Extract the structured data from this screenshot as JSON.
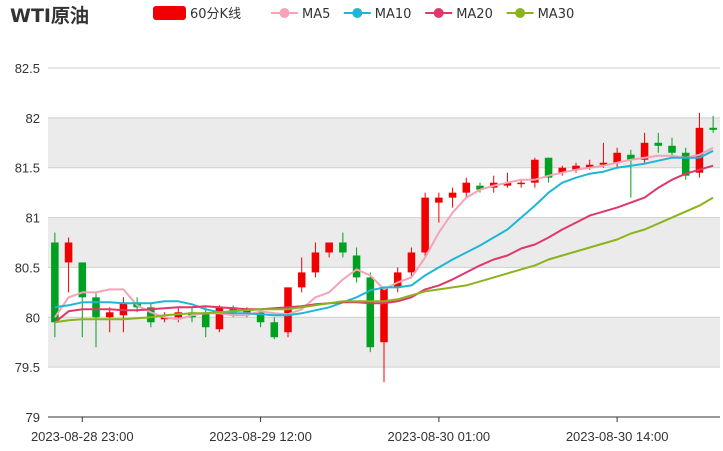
{
  "chart_data": {
    "type": "candlestick",
    "title": "WTI原油",
    "legend": {
      "position": "top",
      "items": [
        {
          "name": "60分K线",
          "color": "#f00000",
          "shape": "rect"
        },
        {
          "name": "MA5",
          "color": "#f5a3b9",
          "shape": "line"
        },
        {
          "name": "MA10",
          "color": "#1fb6d6",
          "shape": "line"
        },
        {
          "name": "MA20",
          "color": "#e0386b",
          "shape": "line"
        },
        {
          "name": "MA30",
          "color": "#8ab41c",
          "shape": "line"
        }
      ]
    },
    "y_axis": {
      "min": 79,
      "max": 82.5,
      "ticks": [
        "79",
        "79.5",
        "80",
        "80.5",
        "81",
        "81.5",
        "82",
        "82.5"
      ]
    },
    "x_axis": {
      "labels": [
        "2023-08-28 23:00",
        "2023-08-29 12:00",
        "2023-08-30 01:00",
        "2023-08-30 14:00"
      ],
      "label_indices": [
        2,
        15,
        28,
        41
      ]
    },
    "grid": "horizontal, alternating shaded bands",
    "up_color": "#f00000",
    "down_color": "#00a020",
    "candles": [
      [
        80.75,
        79.95,
        80.85,
        79.8
      ],
      [
        80.55,
        80.75,
        80.8,
        80.25
      ],
      [
        80.55,
        80.2,
        80.55,
        79.8
      ],
      [
        80.2,
        80.0,
        80.25,
        79.7
      ],
      [
        80.0,
        80.05,
        80.1,
        79.85
      ],
      [
        80.02,
        80.15,
        80.2,
        79.85
      ],
      [
        80.15,
        80.1,
        80.2,
        80.05
      ],
      [
        80.1,
        79.95,
        80.15,
        79.9
      ],
      [
        79.98,
        80.0,
        80.05,
        79.95
      ],
      [
        80.0,
        80.05,
        80.1,
        79.95
      ],
      [
        80.05,
        80.0,
        80.1,
        79.95
      ],
      [
        80.05,
        79.9,
        80.1,
        79.8
      ],
      [
        79.88,
        80.1,
        80.12,
        79.85
      ],
      [
        80.1,
        80.05,
        80.12,
        80.0
      ],
      [
        80.05,
        80.08,
        80.1,
        80.0
      ],
      [
        80.05,
        79.95,
        80.08,
        79.9
      ],
      [
        79.95,
        79.8,
        80.0,
        79.78
      ],
      [
        79.85,
        80.3,
        80.3,
        79.8
      ],
      [
        80.3,
        80.45,
        80.6,
        80.25
      ],
      [
        80.45,
        80.65,
        80.75,
        80.4
      ],
      [
        80.65,
        80.75,
        80.75,
        80.6
      ],
      [
        80.75,
        80.65,
        80.85,
        80.6
      ],
      [
        80.62,
        80.4,
        80.7,
        80.35
      ],
      [
        80.4,
        79.7,
        80.45,
        79.65
      ],
      [
        79.75,
        80.3,
        80.3,
        79.35
      ],
      [
        80.3,
        80.45,
        80.5,
        80.25
      ],
      [
        80.45,
        80.65,
        80.7,
        80.4
      ],
      [
        80.65,
        81.2,
        81.25,
        80.6
      ],
      [
        81.15,
        81.2,
        81.25,
        80.95
      ],
      [
        81.2,
        81.25,
        81.3,
        81.1
      ],
      [
        81.25,
        81.35,
        81.4,
        81.2
      ],
      [
        81.32,
        81.28,
        81.35,
        81.25
      ],
      [
        81.3,
        81.35,
        81.42,
        81.25
      ],
      [
        81.32,
        81.35,
        81.45,
        81.3
      ],
      [
        81.35,
        81.35,
        81.38,
        81.3
      ],
      [
        81.35,
        81.58,
        81.6,
        81.3
      ],
      [
        81.6,
        81.4,
        81.6,
        81.35
      ],
      [
        81.45,
        81.5,
        81.52,
        81.42
      ],
      [
        81.48,
        81.52,
        81.55,
        81.45
      ],
      [
        81.5,
        81.53,
        81.58,
        81.48
      ],
      [
        81.53,
        81.55,
        81.75,
        81.5
      ],
      [
        81.55,
        81.65,
        81.7,
        81.5
      ],
      [
        81.63,
        81.58,
        81.68,
        81.2
      ],
      [
        81.58,
        81.75,
        81.85,
        81.55
      ],
      [
        81.75,
        81.72,
        81.85,
        81.65
      ],
      [
        81.72,
        81.65,
        81.8,
        81.6
      ],
      [
        81.65,
        81.42,
        81.7,
        81.38
      ],
      [
        81.45,
        81.9,
        82.05,
        81.4
      ],
      [
        81.9,
        81.88,
        82.02,
        81.85
      ]
    ],
    "series": [
      {
        "name": "MA5",
        "values": [
          80.0,
          80.2,
          80.25,
          80.25,
          80.28,
          80.28,
          80.12,
          80.05,
          80.0,
          79.98,
          80.02,
          80.04,
          80.04,
          80.02,
          80.02,
          80.06,
          80.04,
          80.03,
          80.08,
          80.2,
          80.25,
          80.38,
          80.48,
          80.42,
          80.28,
          80.35,
          80.4,
          80.6,
          80.85,
          81.05,
          81.2,
          81.28,
          81.32,
          81.35,
          81.38,
          81.38,
          81.42,
          81.45,
          81.48,
          81.5,
          81.52,
          81.55,
          81.58,
          81.6,
          81.62,
          81.62,
          81.6,
          81.63,
          81.7
        ]
      },
      {
        "name": "MA10",
        "values": [
          80.1,
          80.12,
          80.15,
          80.15,
          80.15,
          80.14,
          80.14,
          80.14,
          80.16,
          80.16,
          80.13,
          80.08,
          80.05,
          80.04,
          80.04,
          80.03,
          80.02,
          80.02,
          80.04,
          80.07,
          80.1,
          80.15,
          80.2,
          80.27,
          80.3,
          80.3,
          80.32,
          80.42,
          80.5,
          80.58,
          80.65,
          80.72,
          80.8,
          80.88,
          81.0,
          81.12,
          81.25,
          81.35,
          81.4,
          81.44,
          81.46,
          81.5,
          81.52,
          81.54,
          81.57,
          81.6,
          81.6,
          81.6,
          81.67
        ]
      },
      {
        "name": "MA20",
        "values": [
          79.95,
          80.06,
          80.08,
          80.08,
          80.08,
          80.07,
          80.07,
          80.08,
          80.09,
          80.1,
          80.1,
          80.11,
          80.1,
          80.09,
          80.08,
          80.08,
          80.09,
          80.1,
          80.11,
          80.13,
          80.14,
          80.15,
          80.15,
          80.14,
          80.14,
          80.16,
          80.2,
          80.28,
          80.32,
          80.38,
          80.45,
          80.52,
          80.58,
          80.62,
          80.69,
          80.73,
          80.8,
          80.88,
          80.95,
          81.02,
          81.06,
          81.1,
          81.15,
          81.2,
          81.3,
          81.38,
          81.44,
          81.48,
          81.52
        ]
      },
      {
        "name": "MA30",
        "values": [
          79.95,
          79.97,
          79.98,
          79.98,
          79.98,
          79.98,
          79.99,
          80.0,
          80.02,
          80.03,
          80.04,
          80.04,
          80.05,
          80.06,
          80.07,
          80.08,
          80.08,
          80.08,
          80.1,
          80.12,
          80.14,
          80.16,
          80.16,
          80.16,
          80.16,
          80.18,
          80.22,
          80.26,
          80.28,
          80.3,
          80.32,
          80.36,
          80.4,
          80.44,
          80.48,
          80.52,
          80.58,
          80.62,
          80.66,
          80.7,
          80.74,
          80.78,
          80.84,
          80.88,
          80.94,
          81.0,
          81.06,
          81.12,
          81.2
        ]
      }
    ]
  }
}
